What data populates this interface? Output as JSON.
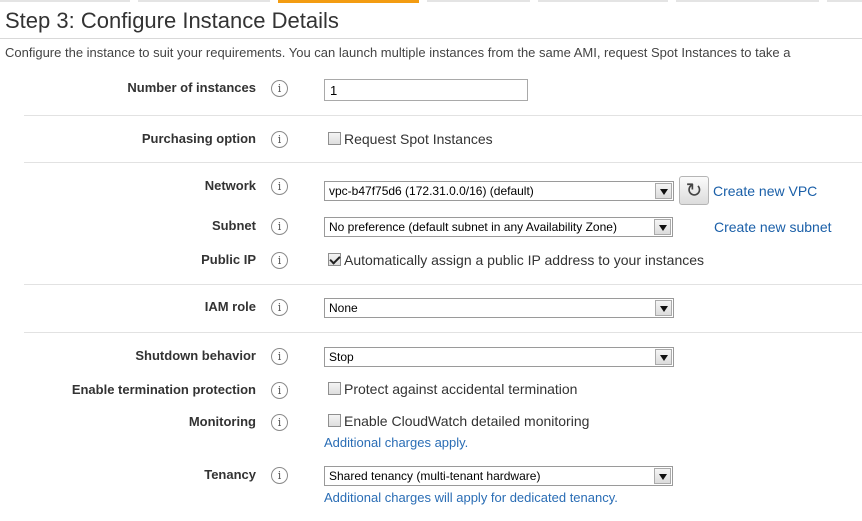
{
  "page": {
    "title": "Step 3: Configure Instance Details",
    "description": "Configure the instance to suit your requirements. You can launch multiple instances from the same AMI, request Spot Instances to take a"
  },
  "info_icon": "i",
  "fields": {
    "number_of_instances": {
      "label": "Number of instances",
      "value": "1"
    },
    "purchasing_option": {
      "label": "Purchasing option",
      "checkbox_label": "Request Spot Instances",
      "checked": false
    },
    "network": {
      "label": "Network",
      "value": "vpc-b47f75d6 (172.31.0.0/16) (default)",
      "refresh_icon": "refresh-icon",
      "link": "Create new VPC"
    },
    "subnet": {
      "label": "Subnet",
      "value": "No preference (default subnet in any Availability Zone)",
      "link": "Create new subnet"
    },
    "public_ip": {
      "label": "Public IP",
      "checkbox_label": "Automatically assign a public IP address to your instances",
      "checked": true
    },
    "iam_role": {
      "label": "IAM role",
      "value": "None"
    },
    "shutdown_behavior": {
      "label": "Shutdown behavior",
      "value": "Stop"
    },
    "termination_protection": {
      "label": "Enable termination protection",
      "checkbox_label": "Protect against accidental termination",
      "checked": false
    },
    "monitoring": {
      "label": "Monitoring",
      "checkbox_label": "Enable CloudWatch detailed monitoring",
      "checked": false,
      "note": "Additional charges apply."
    },
    "tenancy": {
      "label": "Tenancy",
      "value": "Shared tenancy (multi-tenant hardware)",
      "note": "Additional charges will apply for dedicated tenancy."
    }
  },
  "colors": {
    "active_step": "#f39c12",
    "link": "#1a5fa8"
  }
}
